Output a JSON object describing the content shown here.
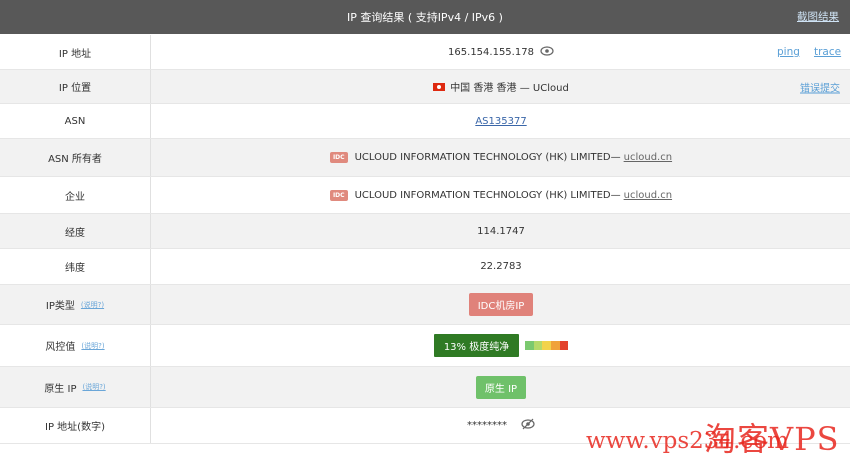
{
  "header": {
    "title": "IP 查询结果 ( 支持IPv4 / IPv6 )",
    "screenshot_link": "截图结果"
  },
  "rows": {
    "ip": {
      "label": "IP 地址",
      "value": "165.154.155.178",
      "ping": "ping",
      "trace": "trace"
    },
    "location": {
      "label": "IP 位置",
      "value": "中国 香港 香港 — UCloud",
      "report": "错误提交"
    },
    "asn": {
      "label": "ASN",
      "value": "AS135377"
    },
    "asn_owner": {
      "label": "ASN 所有者",
      "tag": "IDC",
      "value": "UCLOUD INFORMATION TECHNOLOGY (HK) LIMITED—",
      "domain": "ucloud.cn"
    },
    "company": {
      "label": "企业",
      "tag": "IDC",
      "value": "UCLOUD INFORMATION TECHNOLOGY (HK) LIMITED—",
      "domain": "ucloud.cn"
    },
    "longitude": {
      "label": "经度",
      "value": "114.1747"
    },
    "latitude": {
      "label": "纬度",
      "value": "22.2783"
    },
    "ip_type": {
      "label": "IP类型",
      "hint": "(说明?)",
      "value": "IDC机房IP"
    },
    "risk": {
      "label": "风控值",
      "hint": "(说明?)",
      "value": "13%  极度纯净"
    },
    "native": {
      "label": "原生 IP",
      "hint": "(说明?)",
      "value": "原生 IP"
    },
    "ip_numeric": {
      "label": "IP 地址(数字)",
      "value": "********"
    }
  },
  "risk_scale_colors": [
    "#7bc96f",
    "#b5d96a",
    "#f2d34b",
    "#f0a23a",
    "#e3422c"
  ],
  "watermark": {
    "brand": "淘客VPS",
    "url": "www.vps234.com"
  }
}
